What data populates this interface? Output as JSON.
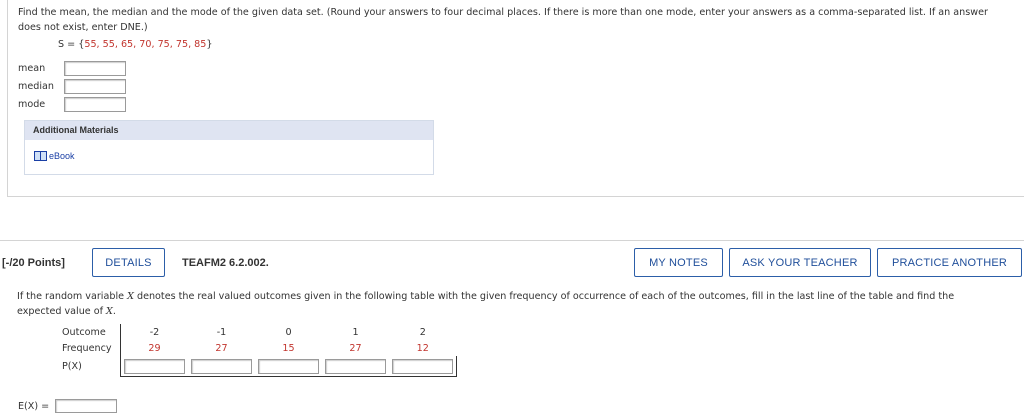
{
  "question1": {
    "prompt": "Find the mean, the median and the mode of the given data set. (Round your answers to four decimal places. If there is more than one mode, enter your answers as a comma-separated list. If an answer does not exist, enter DNE.)",
    "set_prefix": "S = {",
    "set_values": "55, 55, 65, 70, 75, 75, 85",
    "set_suffix": "}",
    "fields": [
      {
        "label": "mean",
        "value": ""
      },
      {
        "label": "median",
        "value": ""
      },
      {
        "label": "mode",
        "value": ""
      }
    ],
    "materials": {
      "heading": "Additional Materials",
      "ebook_label": "eBook"
    }
  },
  "question2": {
    "points": "[-/20 Points]",
    "details_label": "DETAILS",
    "code": "TEAFM2 6.2.002.",
    "my_notes_label": "MY NOTES",
    "ask_teacher_label": "ASK YOUR TEACHER",
    "practice_label": "PRACTICE ANOTHER",
    "prompt_a": "If the random variable",
    "var": "X",
    "prompt_b": "denotes the real valued outcomes given in the following table with the given frequency of occurrence of each of the outcomes, fill in the last line of the table and find the expected value of",
    "prompt_end": ".",
    "table": {
      "outcome_label": "Outcome",
      "frequency_label": "Frequency",
      "px_label": "P(X)",
      "outcomes": [
        "-2",
        "-1",
        "0",
        "1",
        "2"
      ],
      "frequencies": [
        "29",
        "27",
        "15",
        "27",
        "12"
      ]
    },
    "ex_label": "E(X) ="
  },
  "colors": {
    "accent": "#1f4e9a",
    "value_red": "#c2352e",
    "materials_header": "#dfe4f2"
  }
}
